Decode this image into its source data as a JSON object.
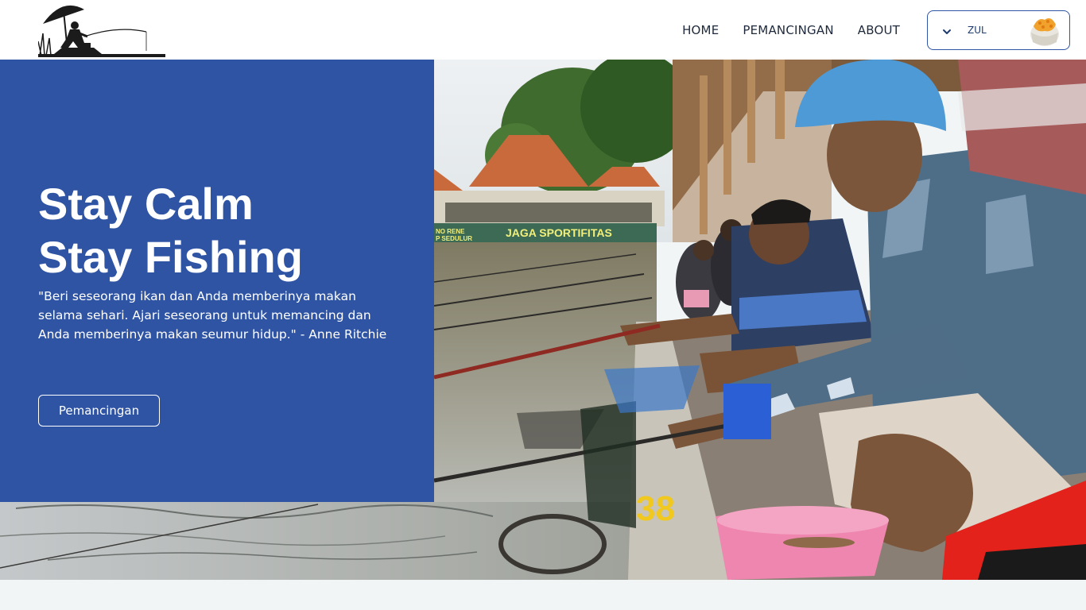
{
  "nav": {
    "links": [
      "HOME",
      "PEMANCINGAN",
      "ABOUT"
    ],
    "user": {
      "name": "ZUL"
    }
  },
  "hero": {
    "title_line1": "Stay Calm",
    "title_line2": "Stay Fishing",
    "quote": "\"Beri seseorang ikan dan Anda memberinya makan selama sehari. Ajari seseorang untuk memancing dan Anda memberinya makan seumur hidup.\" - Anne Ritchie",
    "button_label": "Pemancingan",
    "banner_text_1": "JAGA SPORTIFITAS",
    "banner_text_2": "NO RENE",
    "banner_text_3": "P SEDULUR",
    "stall_number": "38"
  },
  "colors": {
    "primary": "#2f54a4",
    "page_bg": "#f1f5f6"
  },
  "icons": {
    "logo": "fisherman-umbrella-logo",
    "chevron": "chevron-down-icon",
    "avatar": "food-bowl-avatar"
  }
}
